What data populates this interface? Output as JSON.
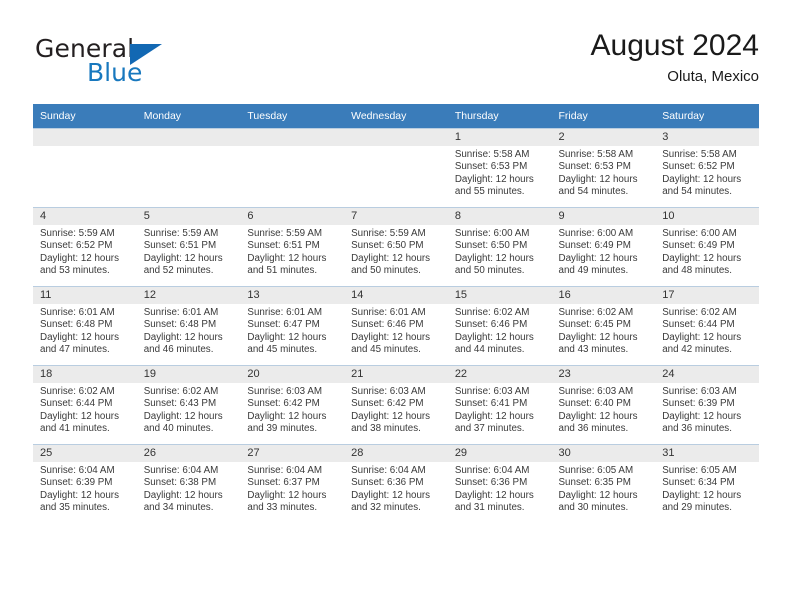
{
  "brand": {
    "name_part1": "General",
    "name_part2": "Blue",
    "accent_color": "#1268b3"
  },
  "header": {
    "title": "August 2024",
    "subtitle": "Oluta, Mexico"
  },
  "calendar": {
    "header_color": "#3a7cba",
    "daynum_strip_color": "#ebebeb",
    "weekday_headers": [
      "Sunday",
      "Monday",
      "Tuesday",
      "Wednesday",
      "Thursday",
      "Friday",
      "Saturday"
    ],
    "weeks": [
      [
        {
          "day": ""
        },
        {
          "day": ""
        },
        {
          "day": ""
        },
        {
          "day": ""
        },
        {
          "day": "1",
          "sunrise": "Sunrise: 5:58 AM",
          "sunset": "Sunset: 6:53 PM",
          "daylight": "Daylight: 12 hours and 55 minutes."
        },
        {
          "day": "2",
          "sunrise": "Sunrise: 5:58 AM",
          "sunset": "Sunset: 6:53 PM",
          "daylight": "Daylight: 12 hours and 54 minutes."
        },
        {
          "day": "3",
          "sunrise": "Sunrise: 5:58 AM",
          "sunset": "Sunset: 6:52 PM",
          "daylight": "Daylight: 12 hours and 54 minutes."
        }
      ],
      [
        {
          "day": "4",
          "sunrise": "Sunrise: 5:59 AM",
          "sunset": "Sunset: 6:52 PM",
          "daylight": "Daylight: 12 hours and 53 minutes."
        },
        {
          "day": "5",
          "sunrise": "Sunrise: 5:59 AM",
          "sunset": "Sunset: 6:51 PM",
          "daylight": "Daylight: 12 hours and 52 minutes."
        },
        {
          "day": "6",
          "sunrise": "Sunrise: 5:59 AM",
          "sunset": "Sunset: 6:51 PM",
          "daylight": "Daylight: 12 hours and 51 minutes."
        },
        {
          "day": "7",
          "sunrise": "Sunrise: 5:59 AM",
          "sunset": "Sunset: 6:50 PM",
          "daylight": "Daylight: 12 hours and 50 minutes."
        },
        {
          "day": "8",
          "sunrise": "Sunrise: 6:00 AM",
          "sunset": "Sunset: 6:50 PM",
          "daylight": "Daylight: 12 hours and 50 minutes."
        },
        {
          "day": "9",
          "sunrise": "Sunrise: 6:00 AM",
          "sunset": "Sunset: 6:49 PM",
          "daylight": "Daylight: 12 hours and 49 minutes."
        },
        {
          "day": "10",
          "sunrise": "Sunrise: 6:00 AM",
          "sunset": "Sunset: 6:49 PM",
          "daylight": "Daylight: 12 hours and 48 minutes."
        }
      ],
      [
        {
          "day": "11",
          "sunrise": "Sunrise: 6:01 AM",
          "sunset": "Sunset: 6:48 PM",
          "daylight": "Daylight: 12 hours and 47 minutes."
        },
        {
          "day": "12",
          "sunrise": "Sunrise: 6:01 AM",
          "sunset": "Sunset: 6:48 PM",
          "daylight": "Daylight: 12 hours and 46 minutes."
        },
        {
          "day": "13",
          "sunrise": "Sunrise: 6:01 AM",
          "sunset": "Sunset: 6:47 PM",
          "daylight": "Daylight: 12 hours and 45 minutes."
        },
        {
          "day": "14",
          "sunrise": "Sunrise: 6:01 AM",
          "sunset": "Sunset: 6:46 PM",
          "daylight": "Daylight: 12 hours and 45 minutes."
        },
        {
          "day": "15",
          "sunrise": "Sunrise: 6:02 AM",
          "sunset": "Sunset: 6:46 PM",
          "daylight": "Daylight: 12 hours and 44 minutes."
        },
        {
          "day": "16",
          "sunrise": "Sunrise: 6:02 AM",
          "sunset": "Sunset: 6:45 PM",
          "daylight": "Daylight: 12 hours and 43 minutes."
        },
        {
          "day": "17",
          "sunrise": "Sunrise: 6:02 AM",
          "sunset": "Sunset: 6:44 PM",
          "daylight": "Daylight: 12 hours and 42 minutes."
        }
      ],
      [
        {
          "day": "18",
          "sunrise": "Sunrise: 6:02 AM",
          "sunset": "Sunset: 6:44 PM",
          "daylight": "Daylight: 12 hours and 41 minutes."
        },
        {
          "day": "19",
          "sunrise": "Sunrise: 6:02 AM",
          "sunset": "Sunset: 6:43 PM",
          "daylight": "Daylight: 12 hours and 40 minutes."
        },
        {
          "day": "20",
          "sunrise": "Sunrise: 6:03 AM",
          "sunset": "Sunset: 6:42 PM",
          "daylight": "Daylight: 12 hours and 39 minutes."
        },
        {
          "day": "21",
          "sunrise": "Sunrise: 6:03 AM",
          "sunset": "Sunset: 6:42 PM",
          "daylight": "Daylight: 12 hours and 38 minutes."
        },
        {
          "day": "22",
          "sunrise": "Sunrise: 6:03 AM",
          "sunset": "Sunset: 6:41 PM",
          "daylight": "Daylight: 12 hours and 37 minutes."
        },
        {
          "day": "23",
          "sunrise": "Sunrise: 6:03 AM",
          "sunset": "Sunset: 6:40 PM",
          "daylight": "Daylight: 12 hours and 36 minutes."
        },
        {
          "day": "24",
          "sunrise": "Sunrise: 6:03 AM",
          "sunset": "Sunset: 6:39 PM",
          "daylight": "Daylight: 12 hours and 36 minutes."
        }
      ],
      [
        {
          "day": "25",
          "sunrise": "Sunrise: 6:04 AM",
          "sunset": "Sunset: 6:39 PM",
          "daylight": "Daylight: 12 hours and 35 minutes."
        },
        {
          "day": "26",
          "sunrise": "Sunrise: 6:04 AM",
          "sunset": "Sunset: 6:38 PM",
          "daylight": "Daylight: 12 hours and 34 minutes."
        },
        {
          "day": "27",
          "sunrise": "Sunrise: 6:04 AM",
          "sunset": "Sunset: 6:37 PM",
          "daylight": "Daylight: 12 hours and 33 minutes."
        },
        {
          "day": "28",
          "sunrise": "Sunrise: 6:04 AM",
          "sunset": "Sunset: 6:36 PM",
          "daylight": "Daylight: 12 hours and 32 minutes."
        },
        {
          "day": "29",
          "sunrise": "Sunrise: 6:04 AM",
          "sunset": "Sunset: 6:36 PM",
          "daylight": "Daylight: 12 hours and 31 minutes."
        },
        {
          "day": "30",
          "sunrise": "Sunrise: 6:05 AM",
          "sunset": "Sunset: 6:35 PM",
          "daylight": "Daylight: 12 hours and 30 minutes."
        },
        {
          "day": "31",
          "sunrise": "Sunrise: 6:05 AM",
          "sunset": "Sunset: 6:34 PM",
          "daylight": "Daylight: 12 hours and 29 minutes."
        }
      ]
    ]
  }
}
